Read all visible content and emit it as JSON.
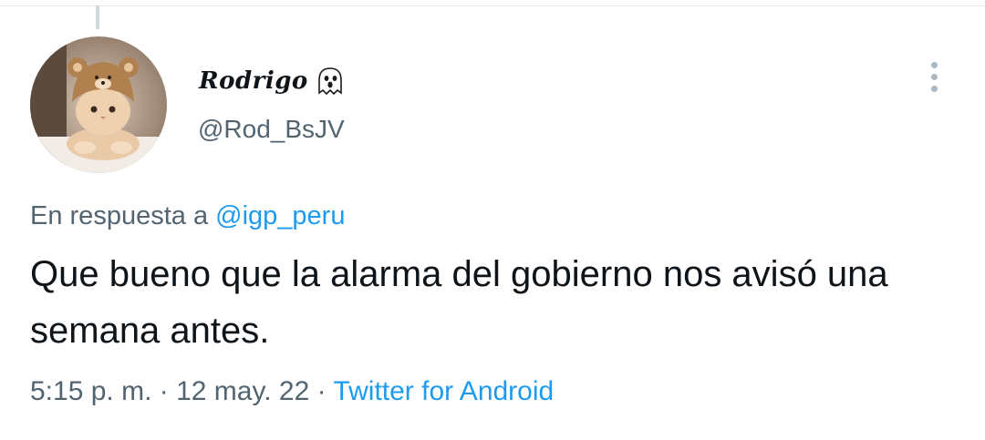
{
  "tweet": {
    "author": {
      "display_name": "Rodrigo",
      "name_emoji_icon": "ghost-icon",
      "handle": "@Rod_BsJV",
      "avatar_icon": "cat-with-bear-hat-avatar"
    },
    "reply_context": {
      "prefix": "En respuesta a",
      "mention": "@igp_peru"
    },
    "text": "Que bueno que la alarma del gobierno nos avisó una semana antes.",
    "time": "5:15 p. m.",
    "separator": "·",
    "date": "12 may. 22",
    "source": "Twitter for Android",
    "more_icon": "more-vertical-icon"
  },
  "colors": {
    "text_primary": "#0f1419",
    "text_secondary": "#536471",
    "link": "#1d9bf0",
    "thread_line": "#cfd9de",
    "more_dots": "#aab8c2"
  }
}
